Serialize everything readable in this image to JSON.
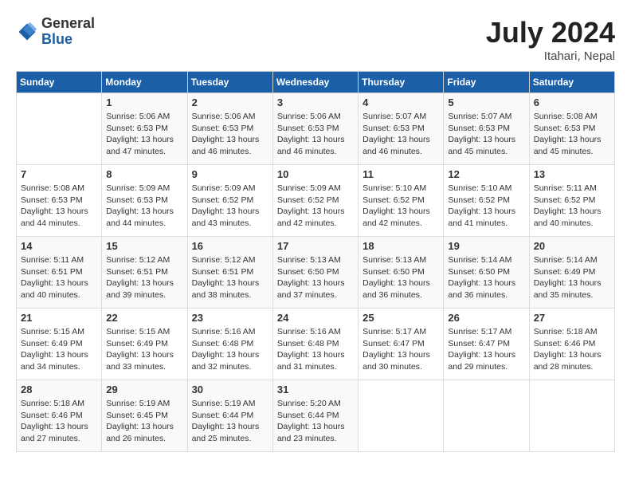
{
  "header": {
    "logo_general": "General",
    "logo_blue": "Blue",
    "month_title": "July 2024",
    "location": "Itahari, Nepal"
  },
  "weekdays": [
    "Sunday",
    "Monday",
    "Tuesday",
    "Wednesday",
    "Thursday",
    "Friday",
    "Saturday"
  ],
  "weeks": [
    [
      {
        "day": "",
        "info": ""
      },
      {
        "day": "1",
        "info": "Sunrise: 5:06 AM\nSunset: 6:53 PM\nDaylight: 13 hours\nand 47 minutes."
      },
      {
        "day": "2",
        "info": "Sunrise: 5:06 AM\nSunset: 6:53 PM\nDaylight: 13 hours\nand 46 minutes."
      },
      {
        "day": "3",
        "info": "Sunrise: 5:06 AM\nSunset: 6:53 PM\nDaylight: 13 hours\nand 46 minutes."
      },
      {
        "day": "4",
        "info": "Sunrise: 5:07 AM\nSunset: 6:53 PM\nDaylight: 13 hours\nand 46 minutes."
      },
      {
        "day": "5",
        "info": "Sunrise: 5:07 AM\nSunset: 6:53 PM\nDaylight: 13 hours\nand 45 minutes."
      },
      {
        "day": "6",
        "info": "Sunrise: 5:08 AM\nSunset: 6:53 PM\nDaylight: 13 hours\nand 45 minutes."
      }
    ],
    [
      {
        "day": "7",
        "info": "Sunrise: 5:08 AM\nSunset: 6:53 PM\nDaylight: 13 hours\nand 44 minutes."
      },
      {
        "day": "8",
        "info": "Sunrise: 5:09 AM\nSunset: 6:53 PM\nDaylight: 13 hours\nand 44 minutes."
      },
      {
        "day": "9",
        "info": "Sunrise: 5:09 AM\nSunset: 6:52 PM\nDaylight: 13 hours\nand 43 minutes."
      },
      {
        "day": "10",
        "info": "Sunrise: 5:09 AM\nSunset: 6:52 PM\nDaylight: 13 hours\nand 42 minutes."
      },
      {
        "day": "11",
        "info": "Sunrise: 5:10 AM\nSunset: 6:52 PM\nDaylight: 13 hours\nand 42 minutes."
      },
      {
        "day": "12",
        "info": "Sunrise: 5:10 AM\nSunset: 6:52 PM\nDaylight: 13 hours\nand 41 minutes."
      },
      {
        "day": "13",
        "info": "Sunrise: 5:11 AM\nSunset: 6:52 PM\nDaylight: 13 hours\nand 40 minutes."
      }
    ],
    [
      {
        "day": "14",
        "info": "Sunrise: 5:11 AM\nSunset: 6:51 PM\nDaylight: 13 hours\nand 40 minutes."
      },
      {
        "day": "15",
        "info": "Sunrise: 5:12 AM\nSunset: 6:51 PM\nDaylight: 13 hours\nand 39 minutes."
      },
      {
        "day": "16",
        "info": "Sunrise: 5:12 AM\nSunset: 6:51 PM\nDaylight: 13 hours\nand 38 minutes."
      },
      {
        "day": "17",
        "info": "Sunrise: 5:13 AM\nSunset: 6:50 PM\nDaylight: 13 hours\nand 37 minutes."
      },
      {
        "day": "18",
        "info": "Sunrise: 5:13 AM\nSunset: 6:50 PM\nDaylight: 13 hours\nand 36 minutes."
      },
      {
        "day": "19",
        "info": "Sunrise: 5:14 AM\nSunset: 6:50 PM\nDaylight: 13 hours\nand 36 minutes."
      },
      {
        "day": "20",
        "info": "Sunrise: 5:14 AM\nSunset: 6:49 PM\nDaylight: 13 hours\nand 35 minutes."
      }
    ],
    [
      {
        "day": "21",
        "info": "Sunrise: 5:15 AM\nSunset: 6:49 PM\nDaylight: 13 hours\nand 34 minutes."
      },
      {
        "day": "22",
        "info": "Sunrise: 5:15 AM\nSunset: 6:49 PM\nDaylight: 13 hours\nand 33 minutes."
      },
      {
        "day": "23",
        "info": "Sunrise: 5:16 AM\nSunset: 6:48 PM\nDaylight: 13 hours\nand 32 minutes."
      },
      {
        "day": "24",
        "info": "Sunrise: 5:16 AM\nSunset: 6:48 PM\nDaylight: 13 hours\nand 31 minutes."
      },
      {
        "day": "25",
        "info": "Sunrise: 5:17 AM\nSunset: 6:47 PM\nDaylight: 13 hours\nand 30 minutes."
      },
      {
        "day": "26",
        "info": "Sunrise: 5:17 AM\nSunset: 6:47 PM\nDaylight: 13 hours\nand 29 minutes."
      },
      {
        "day": "27",
        "info": "Sunrise: 5:18 AM\nSunset: 6:46 PM\nDaylight: 13 hours\nand 28 minutes."
      }
    ],
    [
      {
        "day": "28",
        "info": "Sunrise: 5:18 AM\nSunset: 6:46 PM\nDaylight: 13 hours\nand 27 minutes."
      },
      {
        "day": "29",
        "info": "Sunrise: 5:19 AM\nSunset: 6:45 PM\nDaylight: 13 hours\nand 26 minutes."
      },
      {
        "day": "30",
        "info": "Sunrise: 5:19 AM\nSunset: 6:44 PM\nDaylight: 13 hours\nand 25 minutes."
      },
      {
        "day": "31",
        "info": "Sunrise: 5:20 AM\nSunset: 6:44 PM\nDaylight: 13 hours\nand 23 minutes."
      },
      {
        "day": "",
        "info": ""
      },
      {
        "day": "",
        "info": ""
      },
      {
        "day": "",
        "info": ""
      }
    ]
  ]
}
